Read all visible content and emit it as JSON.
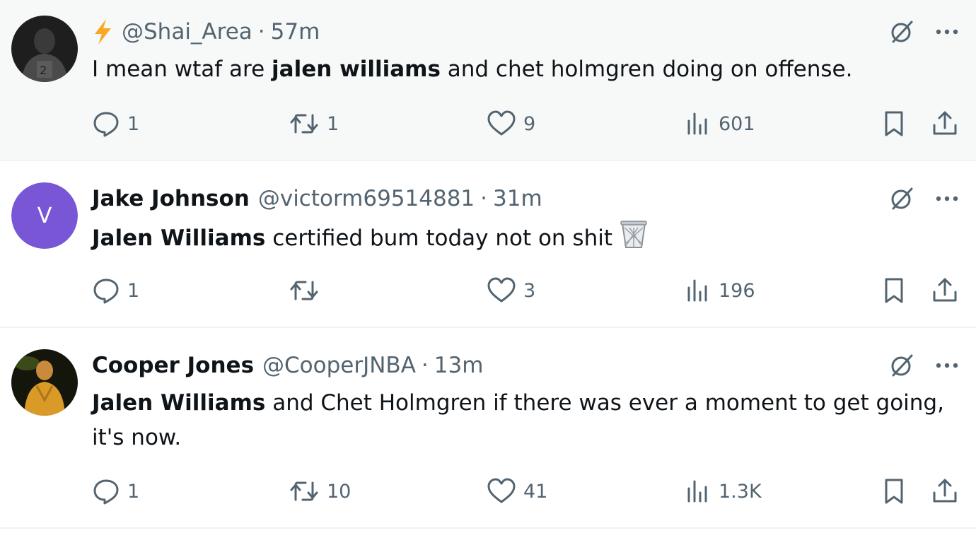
{
  "colors": {
    "text_primary": "#0f1419",
    "text_secondary": "#536471",
    "shaded_background": "#f7f9f9",
    "avatar_v": "#7856d6",
    "bolt": "#f9a825"
  },
  "tweets": [
    {
      "display_name": "",
      "has_bolt_icon": true,
      "handle": "@Shai_Area",
      "separator": "·",
      "time": "57m",
      "text_pre": "I mean wtaf are ",
      "text_bold": "jalen williams",
      "text_post": " and chet holmgren doing on offense.",
      "emoji": "",
      "replies": "1",
      "reposts": "1",
      "likes": "9",
      "views": "601"
    },
    {
      "display_name": "Jake Johnson",
      "avatar_letter": "V",
      "handle": "@victorm69514881",
      "separator": "·",
      "time": "31m",
      "text_pre": "",
      "text_bold": "Jalen Williams",
      "text_post": " certified bum today not on shit ",
      "emoji": "wastebasket-emoji",
      "replies": "1",
      "reposts": "",
      "likes": "3",
      "views": "196"
    },
    {
      "display_name": "Cooper Jones",
      "handle": "@CooperJNBA",
      "separator": "·",
      "time": "13m",
      "text_pre": "",
      "text_bold": "Jalen Williams",
      "text_post": " and Chet Holmgren if there was ever a moment to get going, it's now.",
      "emoji": "",
      "replies": "1",
      "reposts": "10",
      "likes": "41",
      "views": "1.3K"
    }
  ],
  "icons": [
    "reply-icon",
    "retweet-icon",
    "like-icon",
    "views-icon",
    "bookmark-icon",
    "share-icon",
    "grok-icon",
    "more-icon",
    "lightning-bolt-icon",
    "wastebasket-emoji"
  ]
}
